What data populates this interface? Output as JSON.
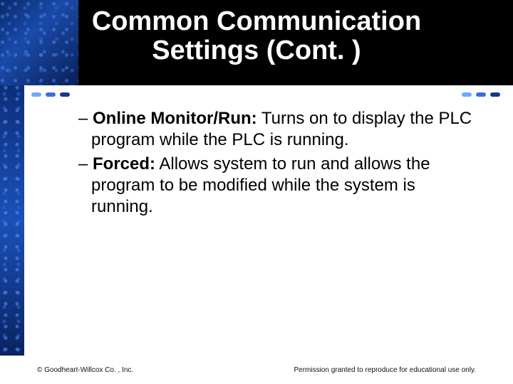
{
  "title": {
    "line1": "Common Communication",
    "line2": "Settings (Cont. )"
  },
  "bullets": [
    {
      "term": "Online Monitor/Run:",
      "desc": "Turns on to display the PLC program while the PLC is running."
    },
    {
      "term": "Forced:",
      "desc": "Allows system to run and allows the program to be modified while the system is running."
    }
  ],
  "footer": {
    "left": "© Goodheart-Willcox Co. , Inc.",
    "right": "Permission granted to reproduce for educational use only."
  },
  "colors": {
    "dot1": "#6fa8ff",
    "dot2": "#3b6fd6",
    "dot3": "#173a8a"
  }
}
